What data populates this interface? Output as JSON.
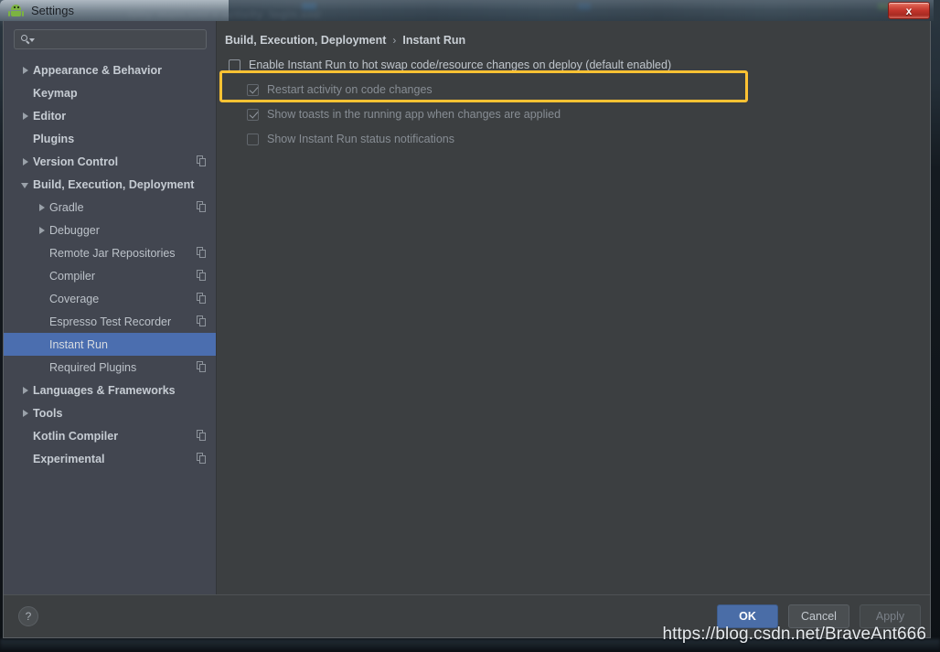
{
  "window": {
    "title": "Settings",
    "app_icon": "android-icon",
    "close_label": "x",
    "background_ghost_text": "ivity_main.xml x  activity_login.xml"
  },
  "sidebar": {
    "search": {
      "value": "",
      "placeholder": ""
    },
    "items": [
      {
        "label": "Appearance & Behavior",
        "arrow": "right",
        "bold": true,
        "indent": 0,
        "copy_icon": false,
        "selected": false
      },
      {
        "label": "Keymap",
        "arrow": "none",
        "bold": true,
        "indent": 0,
        "copy_icon": false,
        "selected": false
      },
      {
        "label": "Editor",
        "arrow": "right",
        "bold": true,
        "indent": 0,
        "copy_icon": false,
        "selected": false
      },
      {
        "label": "Plugins",
        "arrow": "none",
        "bold": true,
        "indent": 0,
        "copy_icon": false,
        "selected": false
      },
      {
        "label": "Version Control",
        "arrow": "right",
        "bold": true,
        "indent": 0,
        "copy_icon": true,
        "selected": false
      },
      {
        "label": "Build, Execution, Deployment",
        "arrow": "down",
        "bold": true,
        "indent": 0,
        "copy_icon": false,
        "selected": false
      },
      {
        "label": "Gradle",
        "arrow": "right",
        "bold": false,
        "indent": 1,
        "copy_icon": true,
        "selected": false
      },
      {
        "label": "Debugger",
        "arrow": "right",
        "bold": false,
        "indent": 1,
        "copy_icon": false,
        "selected": false
      },
      {
        "label": "Remote Jar Repositories",
        "arrow": "none",
        "bold": false,
        "indent": 1,
        "copy_icon": true,
        "selected": false
      },
      {
        "label": "Compiler",
        "arrow": "none",
        "bold": false,
        "indent": 1,
        "copy_icon": true,
        "selected": false
      },
      {
        "label": "Coverage",
        "arrow": "none",
        "bold": false,
        "indent": 1,
        "copy_icon": true,
        "selected": false
      },
      {
        "label": "Espresso Test Recorder",
        "arrow": "none",
        "bold": false,
        "indent": 1,
        "copy_icon": true,
        "selected": false
      },
      {
        "label": "Instant Run",
        "arrow": "none",
        "bold": false,
        "indent": 1,
        "copy_icon": false,
        "selected": true
      },
      {
        "label": "Required Plugins",
        "arrow": "none",
        "bold": false,
        "indent": 1,
        "copy_icon": true,
        "selected": false
      },
      {
        "label": "Languages & Frameworks",
        "arrow": "right",
        "bold": true,
        "indent": 0,
        "copy_icon": false,
        "selected": false
      },
      {
        "label": "Tools",
        "arrow": "right",
        "bold": true,
        "indent": 0,
        "copy_icon": false,
        "selected": false
      },
      {
        "label": "Kotlin Compiler",
        "arrow": "none",
        "bold": true,
        "indent": 0,
        "copy_icon": true,
        "selected": false
      },
      {
        "label": "Experimental",
        "arrow": "none",
        "bold": true,
        "indent": 0,
        "copy_icon": true,
        "selected": false
      }
    ]
  },
  "content": {
    "breadcrumb": {
      "parent": "Build, Execution, Deployment",
      "separator": "›",
      "current": "Instant Run"
    },
    "options": [
      {
        "label": "Enable Instant Run to hot swap code/resource changes on deploy (default enabled)",
        "checked": false,
        "disabled": false,
        "indent": false,
        "highlighted": true
      },
      {
        "label": "Restart activity on code changes",
        "checked": true,
        "disabled": true,
        "indent": true,
        "highlighted": false
      },
      {
        "label": "Show toasts in the running app when changes are applied",
        "checked": true,
        "disabled": true,
        "indent": true,
        "highlighted": false
      },
      {
        "label": "Show Instant Run status notifications",
        "checked": false,
        "disabled": true,
        "indent": true,
        "highlighted": false
      }
    ]
  },
  "footer": {
    "help_label": "?",
    "ok_label": "OK",
    "cancel_label": "Cancel",
    "apply_label": "Apply",
    "apply_disabled": true
  },
  "watermark": {
    "text": "https://blog.csdn.net/BraveAnt666"
  },
  "colors": {
    "accent_selection": "#4b6eaf",
    "highlight_border": "#ffc233",
    "panel_bg": "#3c3f41",
    "sidebar_bg": "#424650",
    "primary_button": "#4a6da7",
    "close_button": "#c0332a"
  }
}
